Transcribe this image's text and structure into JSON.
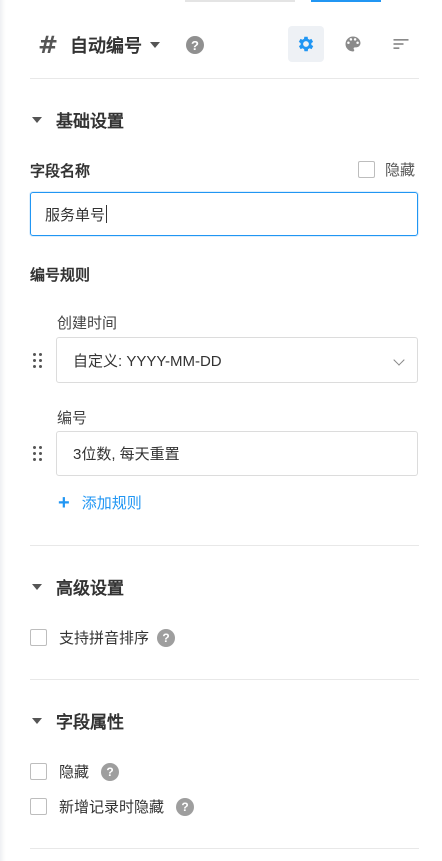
{
  "header": {
    "field_type_symbol": "#",
    "title": "自动编号",
    "help_symbol": "?",
    "tools": [
      "gear-icon",
      "palette-icon",
      "sort-lines-icon"
    ]
  },
  "basic": {
    "section_title": "基础设置",
    "field_name_label": "字段名称",
    "hide_label": "隐藏",
    "field_name_value": "服务单号",
    "rules_label": "编号规则",
    "rules": [
      {
        "label": "创建时间",
        "value": "自定义: YYYY-MM-DD"
      },
      {
        "label": "编号",
        "value": "3位数, 每天重置"
      }
    ],
    "add_rule_label": "添加规则",
    "add_symbol": "+"
  },
  "advanced": {
    "section_title": "高级设置",
    "pinyin_sort_label": "支持拼音排序"
  },
  "properties": {
    "section_title": "字段属性",
    "hide_label": "隐藏",
    "hide_on_new_label": "新增记录时隐藏"
  },
  "colors": {
    "accent": "#2196f3",
    "active_tool_bg": "#eef1f5"
  }
}
